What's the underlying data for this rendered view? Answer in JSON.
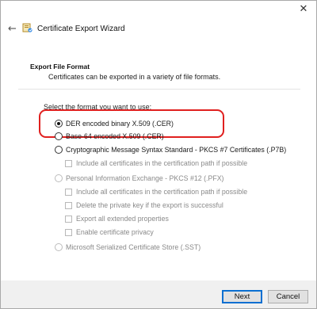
{
  "window": {
    "title": "Certificate Export Wizard",
    "close_glyph": "✕",
    "back_glyph": "←"
  },
  "page": {
    "section_title": "Export File Format",
    "section_desc": "Certificates can be exported in a variety of file formats.",
    "prompt": "Select the format you want to use:"
  },
  "options": {
    "der": "DER encoded binary X.509 (.CER)",
    "base64": "Base-64 encoded X.509 (.CER)",
    "pkcs7": "Cryptographic Message Syntax Standard - PKCS #7 Certificates (.P7B)",
    "pkcs7_include": "Include all certificates in the certification path if possible",
    "pfx": "Personal Information Exchange - PKCS #12 (.PFX)",
    "pfx_include": "Include all certificates in the certification path if possible",
    "pfx_delete_key": "Delete the private key if the export is successful",
    "pfx_export_props": "Export all extended properties",
    "pfx_privacy": "Enable certificate privacy",
    "sst": "Microsoft Serialized Certificate Store (.SST)"
  },
  "selected_option": "der",
  "buttons": {
    "next": "Next",
    "cancel": "Cancel"
  },
  "colors": {
    "highlight": "#e0201f",
    "default_button_border": "#0a6fd1"
  }
}
